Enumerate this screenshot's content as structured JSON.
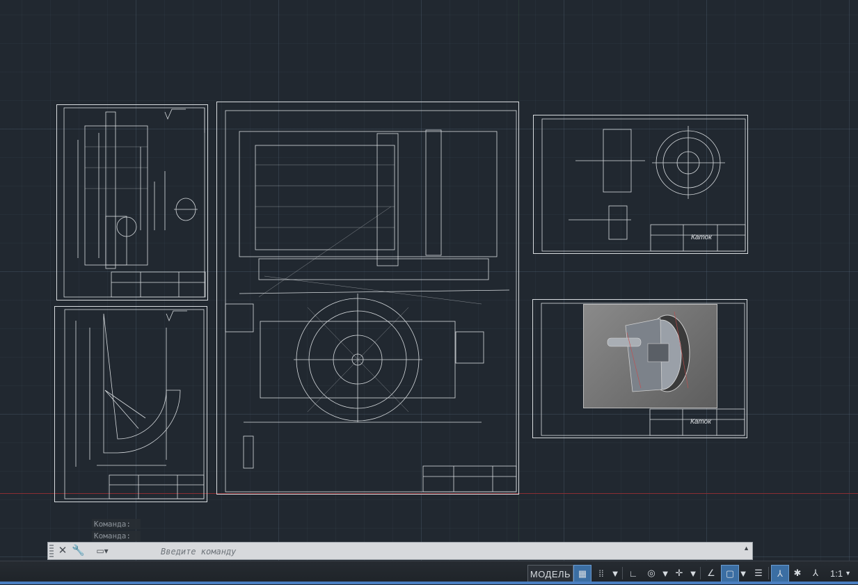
{
  "app": "AutoCAD",
  "sheets": {
    "katok_top": {
      "title": "Каток"
    },
    "katok_bottom": {
      "title": "Каток"
    }
  },
  "command_line": {
    "history": [
      "Команда:",
      "Команда:"
    ],
    "placeholder": "Введите команду"
  },
  "status_bar": {
    "model_label": "МОДЕЛЬ",
    "scale_label": "1:1"
  },
  "colors": {
    "background": "#212830",
    "accent": "#3b6ea3",
    "lines": "#d9dde0"
  }
}
